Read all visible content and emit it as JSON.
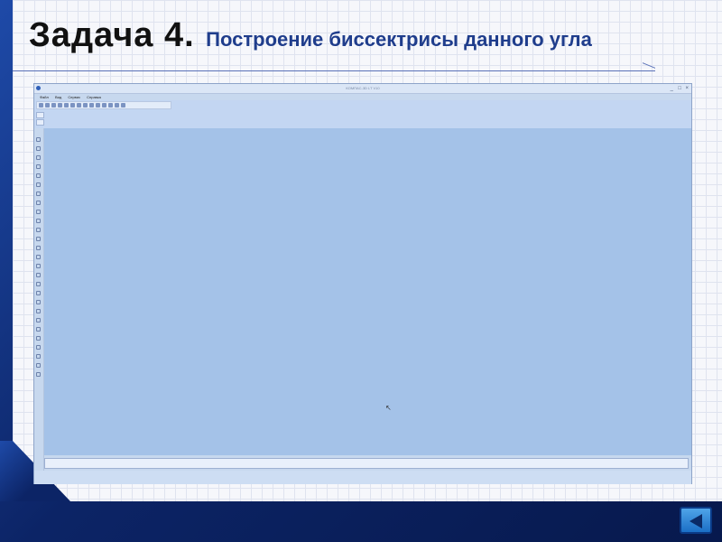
{
  "slide": {
    "title_main": "Задача 4.",
    "title_sub": "Построение биссектрисы данного угла"
  },
  "app_window": {
    "title": "КОМПАС-3D LT V10",
    "controls": {
      "minimize": "_",
      "maximize": "□",
      "close": "×"
    },
    "menu": [
      "Файл",
      "Вид",
      "Сервис",
      "Справка"
    ]
  },
  "colors": {
    "frame_blue": "#0c2466",
    "title_sub": "#1f3d8c",
    "canvas": "#a4c2e8"
  },
  "nav": {
    "icon": "triangle-left-icon"
  }
}
